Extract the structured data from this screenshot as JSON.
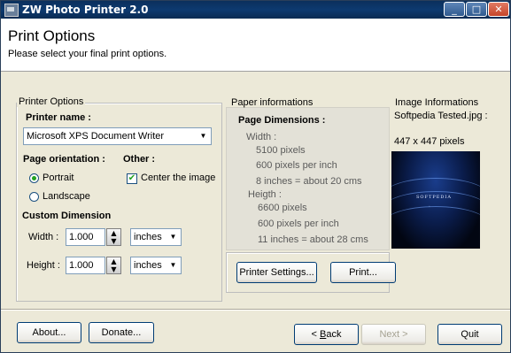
{
  "window": {
    "title": "ZW Photo Printer 2.0",
    "controls": {
      "minimize": "_",
      "maximize": "□",
      "close": "✕"
    }
  },
  "header": {
    "title": "Print Options",
    "subtitle": "Please select your final print options."
  },
  "printer_options": {
    "group_label": "Printer Options",
    "printer_name_label": "Printer name :",
    "printer_selected": "Microsoft XPS Document Writer",
    "orientation_label": "Page orientation :",
    "portrait_label": "Portrait",
    "portrait_selected": true,
    "landscape_label": "Landscape",
    "other_label": "Other :",
    "center_label": "Center the image",
    "center_checked": true,
    "custom_label": "Custom Dimension",
    "width_label": "Width :",
    "width_value": "1.000",
    "width_unit": "inches",
    "height_label": "Height :",
    "height_value": "1.000",
    "height_unit": "inches"
  },
  "paper": {
    "group_label": "Paper informations",
    "dims_label": "Page Dimensions :",
    "width_label": "Width :",
    "width_pixels": "5100 pixels",
    "width_ppi": "600 pixels per inch",
    "width_inches": "8 inches = about 20 cms",
    "height_label": "Heigth :",
    "height_pixels": "6600 pixels",
    "height_ppi": "600 pixels per inch",
    "height_inches": "11 inches = about 28 cms",
    "printer_settings_button": "Printer Settings...",
    "print_button": "Print..."
  },
  "image_info": {
    "group_label": "Image Informations",
    "filename": "Softpedia Tested.jpg :",
    "size": "447 x 447 pixels",
    "preview_text": "SOFTPEDIA"
  },
  "footer": {
    "about": "About...",
    "donate": "Donate...",
    "back_key": "B",
    "back_rest": "ack",
    "next": "Next >",
    "quit": "Quit"
  },
  "colors": {
    "title_bar": "#0d3a70",
    "dialog_bg": "#ece9d8",
    "check_accent": "#21a121"
  }
}
